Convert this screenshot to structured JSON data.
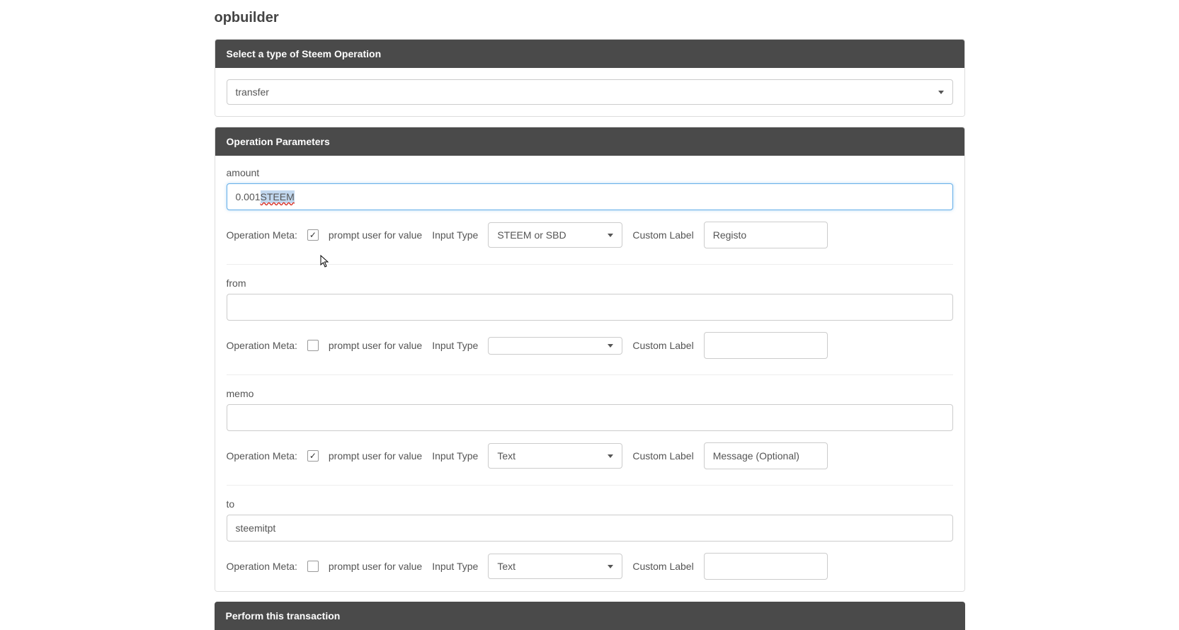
{
  "page": {
    "title": "opbuilder"
  },
  "select_panel": {
    "header": "Select a type of Steem Operation",
    "value": "transfer"
  },
  "params_panel": {
    "header": "Operation Parameters"
  },
  "params": {
    "amount": {
      "label": "amount",
      "value_prefix": "0.001 ",
      "value_selected": "STEEM",
      "meta_label": "Operation Meta:",
      "prompt_checked": true,
      "prompt_label": "prompt user for value",
      "input_type_label": "Input Type",
      "input_type_value": "STEEM or SBD",
      "custom_label_label": "Custom Label",
      "custom_label_value": "Registo"
    },
    "from": {
      "label": "from",
      "value": "",
      "meta_label": "Operation Meta:",
      "prompt_checked": false,
      "prompt_label": "prompt user for value",
      "input_type_label": "Input Type",
      "input_type_value": "",
      "custom_label_label": "Custom Label",
      "custom_label_value": ""
    },
    "memo": {
      "label": "memo",
      "value": "",
      "meta_label": "Operation Meta:",
      "prompt_checked": true,
      "prompt_label": "prompt user for value",
      "input_type_label": "Input Type",
      "input_type_value": "Text",
      "custom_label_label": "Custom Label",
      "custom_label_value": "Message (Optional)"
    },
    "to": {
      "label": "to",
      "value": "steemitpt",
      "meta_label": "Operation Meta:",
      "prompt_checked": false,
      "prompt_label": "prompt user for value",
      "input_type_label": "Input Type",
      "input_type_value": "Text",
      "custom_label_label": "Custom Label",
      "custom_label_value": ""
    }
  },
  "footer": {
    "header": "Perform this transaction"
  }
}
